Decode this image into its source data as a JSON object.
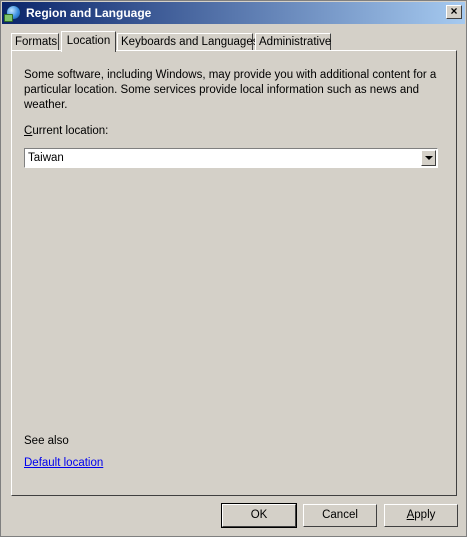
{
  "window": {
    "title": "Region and Language",
    "icon": "globe-icon",
    "close_label": "×"
  },
  "tabs": [
    {
      "label": "Formats",
      "active": false
    },
    {
      "label": "Location",
      "active": true
    },
    {
      "label": "Keyboards and Languages",
      "active": false
    },
    {
      "label": "Administrative",
      "active": false
    }
  ],
  "location_tab": {
    "intro_text": "Some software, including Windows, may provide you with additional content for a particular location. Some services provide local information such as news and weather.",
    "current_location_label_mnemonic": "C",
    "current_location_label_rest": "urrent location:",
    "current_location_value": "Taiwan",
    "see_also": "See also",
    "default_location_link": "Default location"
  },
  "buttons": {
    "ok": "OK",
    "cancel": "Cancel",
    "apply_mnemonic": "A",
    "apply_rest": "pply"
  }
}
